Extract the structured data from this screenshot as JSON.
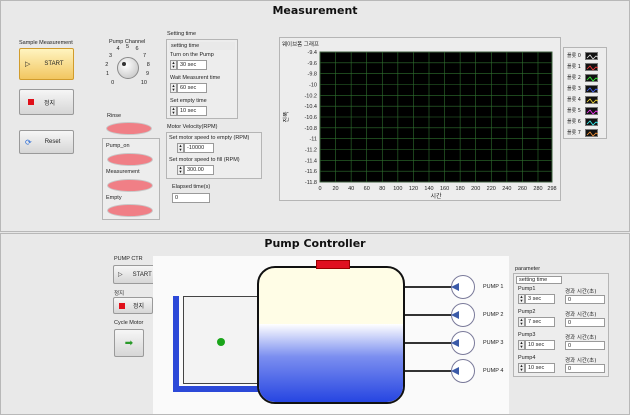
{
  "measurement": {
    "title": "Measurement",
    "sample_label": "Sample Measurement",
    "start_label": "START",
    "stop_label": "정지",
    "reset_label": "Reset",
    "pump_channel_label": "Pump Channel",
    "dial_ticks": [
      "0",
      "1",
      "2",
      "3",
      "4",
      "5",
      "6",
      "7",
      "8",
      "9",
      "10"
    ],
    "rinse_label": "Rinse",
    "pump_on_label": "Pump_on",
    "measurement_label": "Measurement",
    "empty_label": "Empty",
    "setting_time_label": "Setting time",
    "setting_time_inner": "setting time",
    "turn_on_label": "Turn on the Pump",
    "turn_on_value": "30 sec",
    "wait_label": "Wait Measurent time",
    "wait_value": "60 sec",
    "empty_time_label": "Set empty time",
    "empty_time_value": "10 sec",
    "motor_velocity_label": "Motor Velocity(RPM)",
    "motor_empty_label": "Set motor speed to empty (RPM)",
    "motor_empty_value": "-10000",
    "motor_fill_label": "Set motor speed to fill (RPM)",
    "motor_fill_value": "300.00",
    "elapsed_label": "Elapsed time(s)",
    "elapsed_value": "0"
  },
  "chart_data": {
    "type": "line",
    "title": "웨이브폼 그래프",
    "xlabel": "시간",
    "ylabel": "진폭",
    "xlim": [
      0,
      298
    ],
    "ylim": [
      -11.8,
      -9.4
    ],
    "x_ticks": [
      "0",
      "20",
      "40",
      "60",
      "80",
      "100",
      "120",
      "140",
      "160",
      "180",
      "200",
      "220",
      "240",
      "260",
      "280",
      "298"
    ],
    "y_ticks": [
      "-9.4",
      "-9.6",
      "-9.8",
      "-10",
      "-10.2",
      "-10.4",
      "-10.6",
      "-10.8",
      "-11",
      "-11.2",
      "-11.4",
      "-11.6",
      "-11.8"
    ],
    "grid": true,
    "background": "#000000",
    "grid_color": "#2f6f2f",
    "legend_position": "right",
    "series": [
      {
        "name": "플롯 0",
        "values": []
      },
      {
        "name": "플롯 1",
        "values": []
      },
      {
        "name": "플롯 2",
        "values": []
      },
      {
        "name": "플롯 3",
        "values": []
      },
      {
        "name": "플롯 4",
        "values": []
      },
      {
        "name": "플롯 5",
        "values": []
      },
      {
        "name": "플롯 6",
        "values": []
      },
      {
        "name": "플롯 7",
        "values": []
      }
    ],
    "series_colors": [
      "#e8e8e8",
      "#ff3b3b",
      "#3bff3b",
      "#4a6bff",
      "#ffe23b",
      "#ff3bff",
      "#3bffff",
      "#ff9a3b"
    ]
  },
  "pump_controller": {
    "title": "Pump Controller",
    "pump_ctr_label": "PUMP CTR",
    "start_label": "START",
    "stop_group_label": "정지",
    "stop_label": "정지",
    "cycle_motor_label": "Cycle Motor",
    "pumps": [
      "PUMP 1",
      "PUMP 2",
      "PUMP 3",
      "PUMP 4"
    ],
    "parameter_label": "parameter",
    "setting_time_label": "setting time",
    "params": [
      {
        "name": "Pump1",
        "value": "3 sec",
        "elapsed_label": "경과 시간(초)",
        "elapsed_value": "0"
      },
      {
        "name": "Pump2",
        "value": "7 sec",
        "elapsed_label": "경과 시간(초)",
        "elapsed_value": "0"
      },
      {
        "name": "Pump3",
        "value": "10 sec",
        "elapsed_label": "경과 시간(초)",
        "elapsed_value": "0"
      },
      {
        "name": "Pump4",
        "value": "10 sec",
        "elapsed_label": "경과 시간(초)",
        "elapsed_value": "0"
      }
    ],
    "colors": {
      "water": "#2c49d8",
      "tank_red": "#e01020",
      "led_green": "#1aa51a"
    }
  }
}
